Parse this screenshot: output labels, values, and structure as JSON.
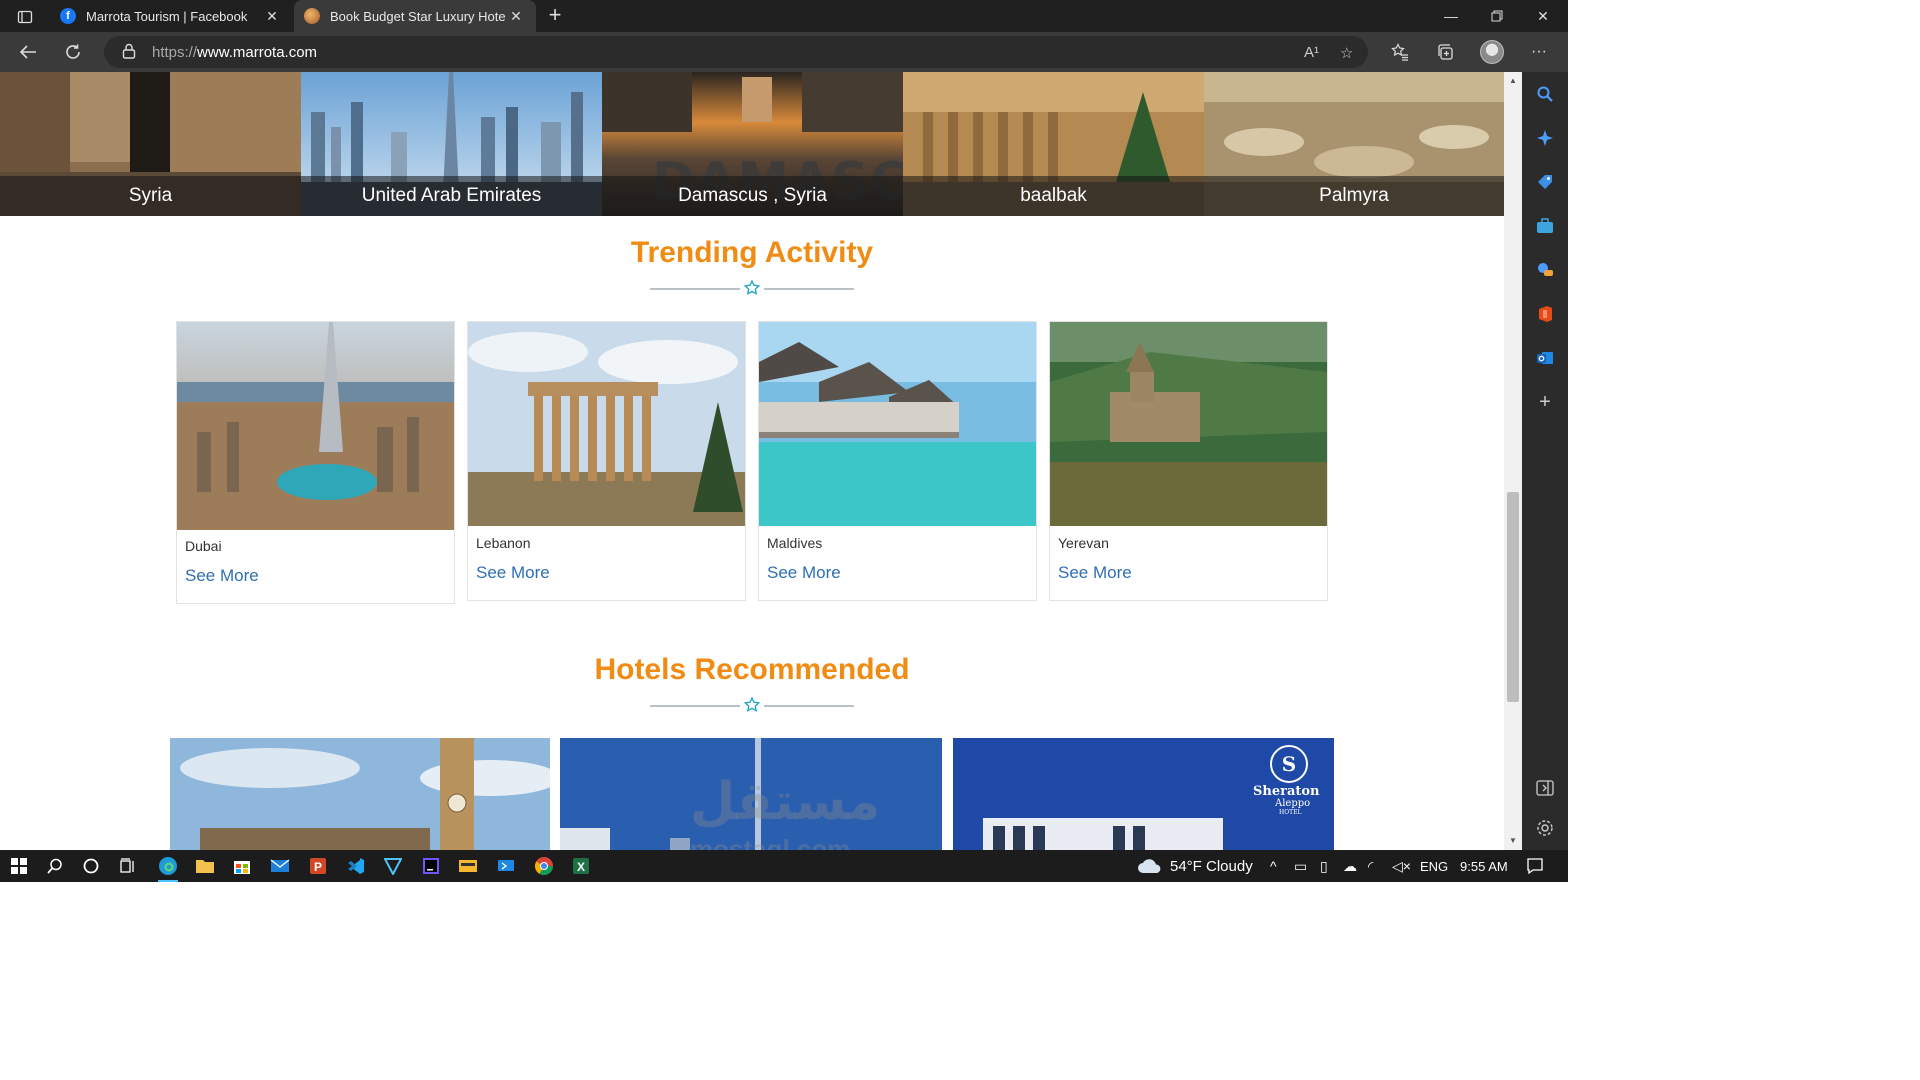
{
  "browser": {
    "tabs": [
      {
        "title": "Marrota Tourism | Facebook",
        "favicon": "facebook-icon",
        "active": false
      },
      {
        "title": "Book Budget Star Luxury Hotels,",
        "favicon": "site-globe-icon",
        "active": true
      }
    ],
    "url_proto": "https://",
    "url_host": "www.marrota.com",
    "read_aloud_label": "A¹"
  },
  "destinations": [
    {
      "name": "Syria"
    },
    {
      "name": "United Arab Emirates"
    },
    {
      "name": "Damascus , Syria",
      "overlay_word": "DAMASCUS"
    },
    {
      "name": "baalbak"
    },
    {
      "name": "Palmyra"
    }
  ],
  "trending": {
    "title": "Trending Activity",
    "cards": [
      {
        "place": "Dubai",
        "link": "See More"
      },
      {
        "place": "Lebanon",
        "link": "See More"
      },
      {
        "place": "Maldives",
        "link": "See More"
      },
      {
        "place": "Yerevan",
        "link": "See More"
      }
    ]
  },
  "hotels": {
    "title": "Hotels Recommended",
    "sheraton_logo": {
      "brand": "Sheraton",
      "city": "Aleppo",
      "sub": "HOTEL"
    }
  },
  "watermark": {
    "arabic": "مستقل",
    "latin": "mostaql.com"
  },
  "taskbar": {
    "weather": "54°F  Cloudy",
    "language": "ENG",
    "time": "9:55 AM"
  },
  "colors": {
    "heading_orange": "#f08c13",
    "link_blue": "#2f6fb4",
    "star_teal": "#1aa3c7"
  }
}
